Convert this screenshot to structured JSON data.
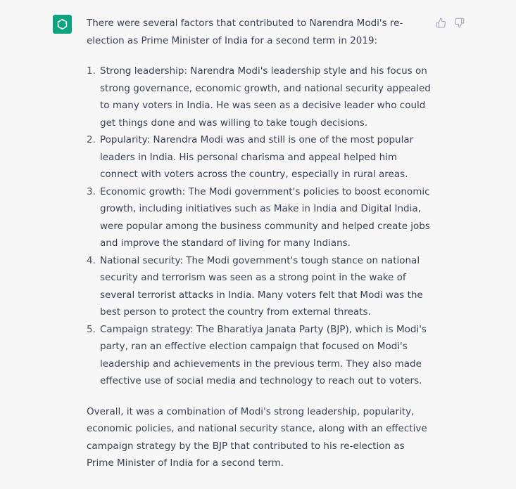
{
  "colors": {
    "background": "#f7f7f8",
    "avatar": "#10a37f",
    "text": "#374151",
    "icon": "#acacbe"
  },
  "avatar": {
    "icon": "openai-logo-icon"
  },
  "feedback": {
    "thumbs_up_icon": "thumbs-up-icon",
    "thumbs_down_icon": "thumbs-down-icon"
  },
  "response": {
    "intro": "There were several factors that contributed to Narendra Modi's re-election as Prime Minister of India for a second term in 2019:",
    "items": [
      {
        "number": "1.",
        "text": "Strong leadership: Narendra Modi's leadership style and his focus on strong governance, economic growth, and national security appealed to many voters in India. He was seen as a decisive leader who could get things done and was willing to take tough decisions."
      },
      {
        "number": "2.",
        "text": "Popularity: Narendra Modi was and still is one of the most popular leaders in India. His personal charisma and appeal helped him connect with voters across the country, especially in rural areas."
      },
      {
        "number": "3.",
        "text": "Economic growth: The Modi government's policies to boost economic growth, including initiatives such as Make in India and Digital India, were popular among the business community and helped create jobs and improve the standard of living for many Indians."
      },
      {
        "number": "4.",
        "text": "National security: The Modi government's tough stance on national security and terrorism was seen as a strong point in the wake of several terrorist attacks in India. Many voters felt that Modi was the best person to protect the country from external threats."
      },
      {
        "number": "5.",
        "text": "Campaign strategy: The Bharatiya Janata Party (BJP), which is Modi's party, ran an effective election campaign that focused on Modi's leadership and achievements in the previous term. They also made effective use of social media and technology to reach out to voters."
      }
    ],
    "conclusion": "Overall, it was a combination of Modi's strong leadership, popularity, economic policies, and national security stance, along with an effective campaign strategy by the BJP that contributed to his re-election as Prime Minister of India for a second term."
  }
}
